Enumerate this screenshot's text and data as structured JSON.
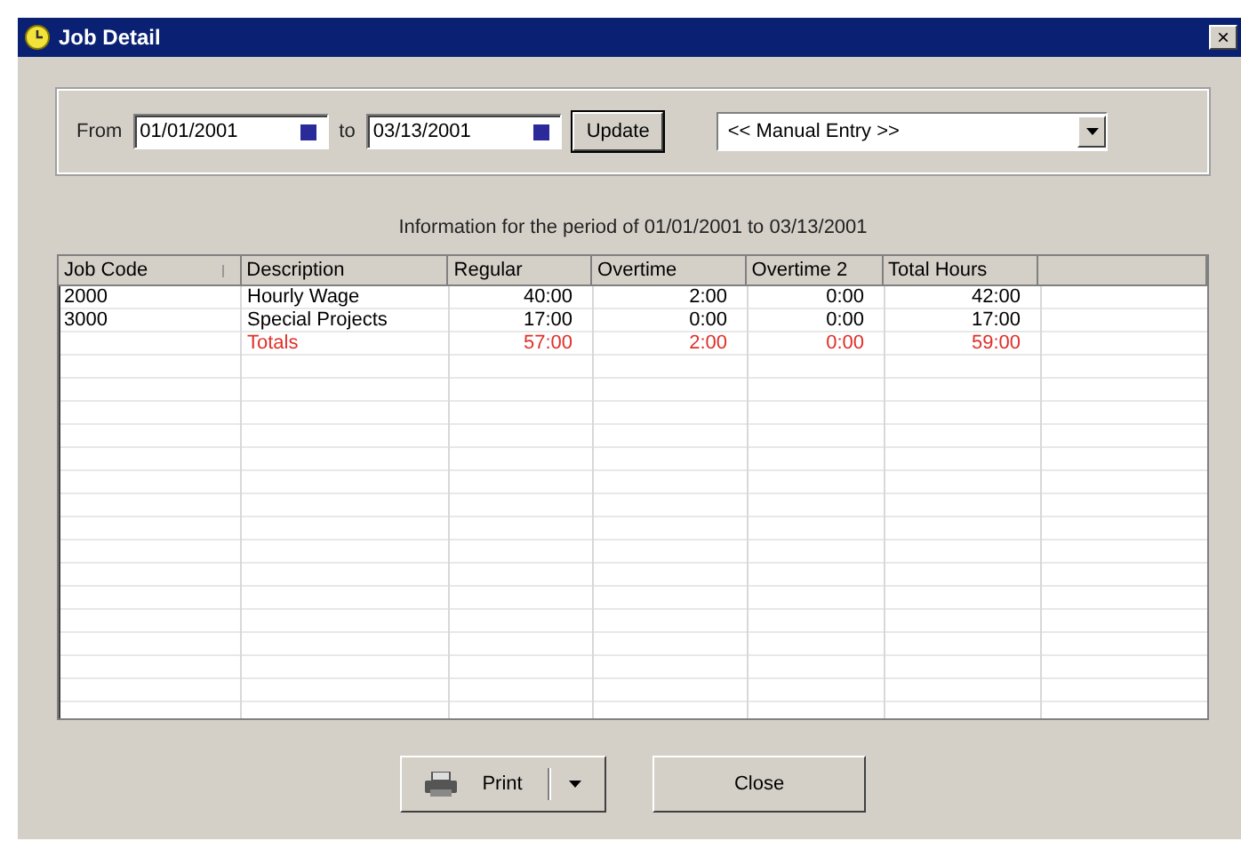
{
  "window": {
    "title": "Job Detail",
    "close": "×"
  },
  "filter": {
    "from_label": "From",
    "from_date": "01/01/2001",
    "to_label": "to",
    "to_date": "03/13/2001",
    "update_button": "Update",
    "entry_select": "<< Manual Entry >>"
  },
  "info": "Information for the period of 01/01/2001 to 03/13/2001",
  "table": {
    "columns": [
      "Job Code",
      "Description",
      "Regular",
      "Overtime",
      "Overtime 2",
      "Total Hours"
    ],
    "rows": [
      {
        "kind": "item",
        "cells": [
          "2000",
          "Hourly Wage",
          "40:00",
          "2:00",
          "0:00",
          "42:00"
        ]
      },
      {
        "kind": "item",
        "cells": [
          "3000",
          "Special Projects",
          "17:00",
          "0:00",
          "0:00",
          "17:00"
        ]
      },
      {
        "kind": "total",
        "cells": [
          "",
          "Totals",
          "57:00",
          "2:00",
          "0:00",
          "59:00"
        ]
      }
    ]
  },
  "buttons": {
    "print": "Print",
    "close": "Close"
  }
}
